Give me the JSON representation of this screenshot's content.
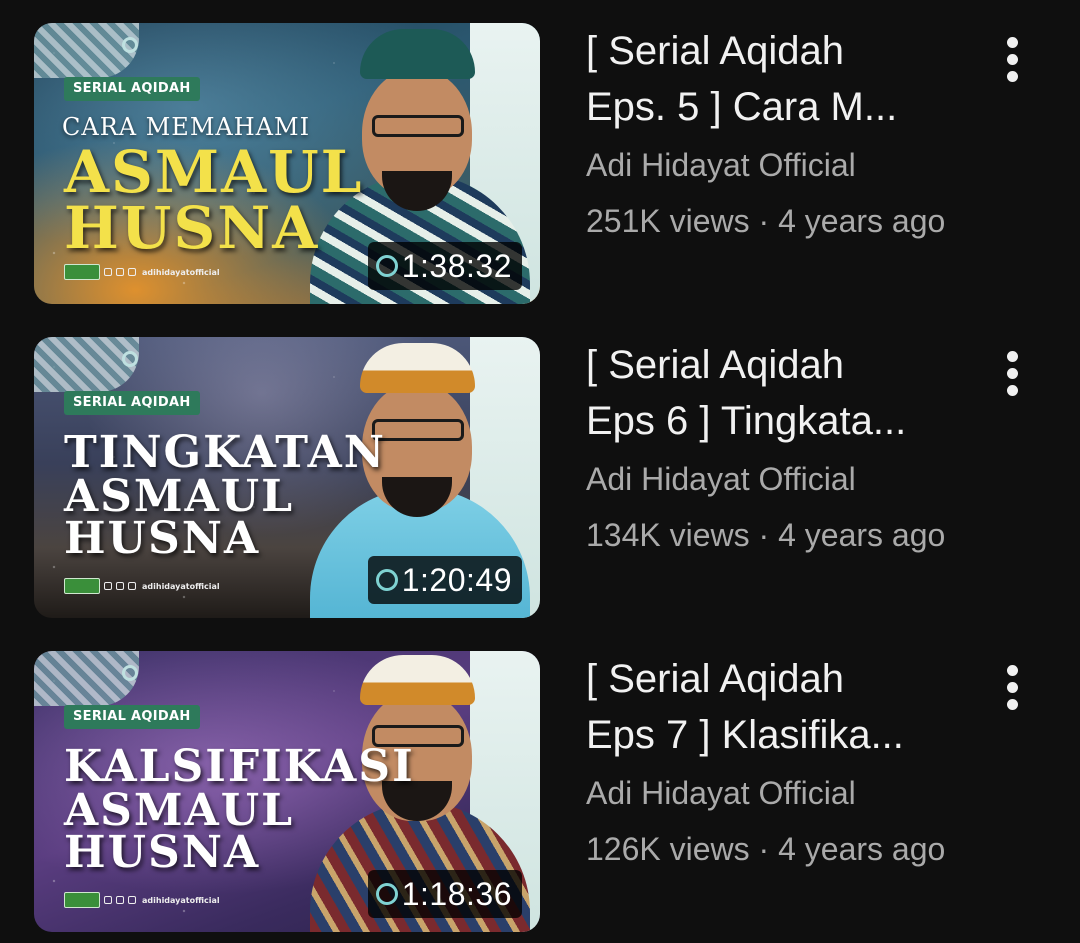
{
  "videos": [
    {
      "title_line1": "[ Serial Aqidah",
      "title_line2": "Eps. 5 ] Cara M...",
      "channel": "Adi Hidayat Official",
      "stats": "251K views · 4 years ago",
      "duration": "1:38:32",
      "thumb": {
        "badge": "SERIAL AQIDAH",
        "subtitle": "CARA MEMAHAMI",
        "line_a": "ASMAUL",
        "line_b": "HUSNA",
        "handle": "adihidayatofficial"
      }
    },
    {
      "title_line1": "[ Serial Aqidah",
      "title_line2": "Eps 6 ] Tingkata...",
      "channel": "Adi Hidayat Official",
      "stats": "134K views · 4 years ago",
      "duration": "1:20:49",
      "thumb": {
        "badge": "SERIAL AQIDAH",
        "line_a": "TINGKATAN",
        "line_b": "ASMAUL",
        "line_c": "HUSNA",
        "handle": "adihidayatofficial"
      }
    },
    {
      "title_line1": "[ Serial Aqidah",
      "title_line2": "Eps 7 ] Klasifika...",
      "channel": "Adi Hidayat Official",
      "stats": "126K views · 4 years ago",
      "duration": "1:18:36",
      "thumb": {
        "badge": "SERIAL AQIDAH",
        "line_a": "KALSIFIKASI",
        "line_b": "ASMAUL",
        "line_c": "HUSNA",
        "handle": "adihidayatofficial"
      }
    }
  ],
  "icons": {
    "more_menu": "more-vertical-icon",
    "duration_badge_ornament": "gear-icon"
  },
  "colors": {
    "background": "#0f0f0f",
    "title": "#f1f1f1",
    "secondary_text": "#aaaaaa",
    "badge_green": "#2e7a5b",
    "title_yellow": "#f3e14a"
  }
}
